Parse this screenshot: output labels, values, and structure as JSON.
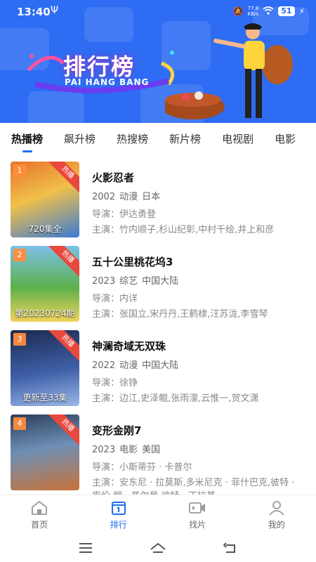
{
  "status_bar": {
    "time": "13:40",
    "usb_icon": "usb-icon",
    "speed_value": "77.8",
    "speed_unit": "KB/s",
    "battery": "51"
  },
  "banner": {
    "title": "排行榜",
    "subtitle": "PAI HANG BANG",
    "bg_color": "#2d6cf3"
  },
  "tabs": [
    {
      "label": "热播榜",
      "active": true
    },
    {
      "label": "飙升榜",
      "active": false
    },
    {
      "label": "热搜榜",
      "active": false
    },
    {
      "label": "新片榜",
      "active": false
    },
    {
      "label": "电视剧",
      "active": false
    },
    {
      "label": "电影",
      "active": false
    }
  ],
  "list": [
    {
      "rank": "1",
      "badge": "热播",
      "episode": "720集全",
      "title": "火影忍者",
      "year": "2002",
      "genre": "动漫",
      "region": "日本",
      "director_label": "导演：",
      "director": "伊达勇登",
      "cast_label": "主演：",
      "cast": "竹内顺子,杉山纪彰,中村千绘,井上和彦",
      "poster_colors": [
        "#e8722a",
        "#f0c04a",
        "#3a7bd5"
      ]
    },
    {
      "rank": "2",
      "badge": "热播",
      "episode": "第20230724期",
      "title": "五十公里桃花坞3",
      "year": "2023",
      "genre": "综艺",
      "region": "中国大陆",
      "director_label": "导演：",
      "director": "内详",
      "cast_label": "主演：",
      "cast": "张国立,宋丹丹,王鹤棣,汪苏泷,李雪琴",
      "poster_colors": [
        "#7cc0e8",
        "#5db04c",
        "#f2d35a"
      ]
    },
    {
      "rank": "3",
      "badge": "热播",
      "episode": "更新至33集",
      "title": "神澜奇域无双珠",
      "year": "2022",
      "genre": "动漫",
      "region": "中国大陆",
      "director_label": "导演：",
      "director": "徐铮",
      "cast_label": "主演：",
      "cast": "边江,史泽鲲,张雨濛,云惟一,贺文潇",
      "poster_colors": [
        "#1d2a4d",
        "#3e5fa8",
        "#9bb7e8"
      ]
    },
    {
      "rank": "4",
      "badge": "热播",
      "episode": "",
      "title": "变形金刚7",
      "year": "2023",
      "genre": "电影",
      "region": "美国",
      "director_label": "导演：",
      "director": "小斯蒂芬 · 卡普尔",
      "cast_label": "主演：",
      "cast": "安东尼 · 拉莫斯,多米尼克 · 菲什巴克,彼特 · 库伦,朗 · 普尔曼,彼特 · 丁拉基",
      "poster_colors": [
        "#2b3e5c",
        "#c8733a",
        "#6e8fb5"
      ]
    }
  ],
  "bottom_nav": [
    {
      "label": "首页",
      "icon": "home-icon",
      "active": false
    },
    {
      "label": "排行",
      "icon": "ranking-icon",
      "active": true
    },
    {
      "label": "找片",
      "icon": "video-camera-icon",
      "active": false
    },
    {
      "label": "我的",
      "icon": "user-icon",
      "active": false
    }
  ],
  "system_nav": [
    "menu-icon",
    "home-outline-icon",
    "back-icon"
  ],
  "accent_color": "#1e6ef5",
  "badge_color": "#e8483d"
}
